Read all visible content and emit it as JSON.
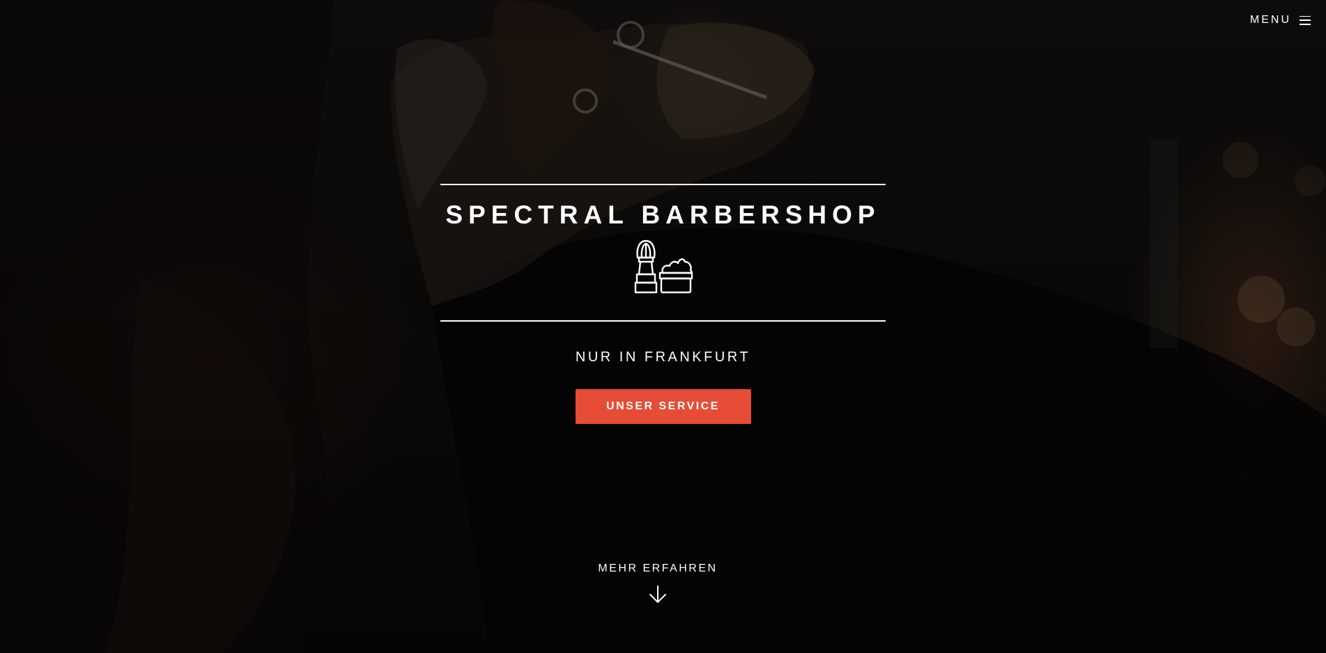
{
  "header": {
    "menu_label": "MENU",
    "menu_icon": "hamburger-icon"
  },
  "hero": {
    "title": "SPECTRAL BARBERSHOP",
    "logo_icon": "shaving-brush-and-cream-icon",
    "subtitle": "NUR IN FRANKFURT",
    "cta_label": "UNSER SERVICE",
    "more_label": "MEHR ERFAHREN",
    "more_icon": "arrow-down-icon"
  },
  "colors": {
    "accent": "#e64c36",
    "text": "#ffffff",
    "background": "#0b0a09"
  }
}
